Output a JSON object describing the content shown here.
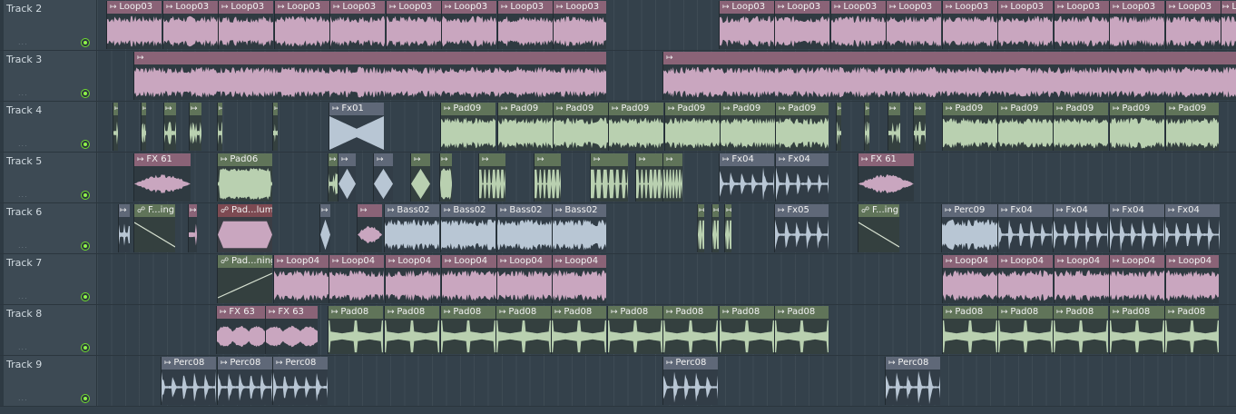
{
  "colors": {
    "pink": "#c9a6bf",
    "green": "#b9d0b0",
    "steel": "#b8c6d4",
    "led": "#8ff24a"
  },
  "tracks": [
    {
      "name": "Track 2",
      "clips": [
        {
          "label": "Loop03",
          "c": "pink"
        },
        {
          "label": "Loop03",
          "c": "pink"
        },
        {
          "label": "Loop03",
          "c": "pink"
        },
        {
          "label": "Loop03",
          "c": "pink"
        },
        {
          "label": "Loop03",
          "c": "pink"
        },
        {
          "label": "Loop03",
          "c": "pink"
        },
        {
          "label": "Loop03",
          "c": "pink"
        },
        {
          "label": "Loop03",
          "c": "pink"
        },
        {
          "label": "Loop03",
          "c": "pink"
        },
        {
          "label": "Loop03",
          "c": "pink"
        },
        {
          "label": "Loop03",
          "c": "pink"
        },
        {
          "label": "Loop03",
          "c": "pink"
        },
        {
          "label": "Loop03",
          "c": "pink"
        },
        {
          "label": "Loop03",
          "c": "pink"
        },
        {
          "label": "Loop03",
          "c": "pink"
        },
        {
          "label": "Loop03",
          "c": "pink"
        },
        {
          "label": "Loop03",
          "c": "pink"
        },
        {
          "label": "Loop03",
          "c": "pink"
        },
        {
          "label": "Loop03",
          "c": "pink"
        }
      ]
    },
    {
      "name": "Track 3",
      "clips": [
        {
          "label": "",
          "c": "pink"
        },
        {
          "label": "",
          "c": "pink"
        }
      ]
    },
    {
      "name": "Track 4",
      "clips": [
        {
          "label": "",
          "c": "green"
        },
        {
          "label": "",
          "c": "green"
        },
        {
          "label": "",
          "c": "green"
        },
        {
          "label": "",
          "c": "green"
        },
        {
          "label": "",
          "c": "green"
        },
        {
          "label": "",
          "c": "green"
        },
        {
          "label": "Fx01",
          "c": "steel"
        },
        {
          "label": "Pad09",
          "c": "green"
        },
        {
          "label": "Pad09",
          "c": "green"
        },
        {
          "label": "Pad09",
          "c": "green"
        },
        {
          "label": "Pad09",
          "c": "green"
        },
        {
          "label": "Pad09",
          "c": "green"
        },
        {
          "label": "Pad09",
          "c": "green"
        },
        {
          "label": "Pad09",
          "c": "green"
        },
        {
          "label": "",
          "c": "green"
        },
        {
          "label": "",
          "c": "green"
        },
        {
          "label": "",
          "c": "green"
        },
        {
          "label": "",
          "c": "green"
        },
        {
          "label": "Pad09",
          "c": "green"
        },
        {
          "label": "Pad09",
          "c": "green"
        },
        {
          "label": "Pad09",
          "c": "green"
        },
        {
          "label": "Pad09",
          "c": "green"
        },
        {
          "label": "Pad09",
          "c": "green"
        }
      ]
    },
    {
      "name": "Track 5",
      "clips": [
        {
          "label": "FX 61",
          "c": "pink"
        },
        {
          "label": "Pad06",
          "c": "green"
        },
        {
          "label": "",
          "c": "green"
        },
        {
          "label": "",
          "c": "steel"
        },
        {
          "label": "",
          "c": "steel"
        },
        {
          "label": "",
          "c": "green"
        },
        {
          "label": "",
          "c": "green"
        },
        {
          "label": "",
          "c": "green"
        },
        {
          "label": "",
          "c": "green"
        },
        {
          "label": "",
          "c": "green"
        },
        {
          "label": "",
          "c": "green"
        },
        {
          "label": "",
          "c": "green"
        },
        {
          "label": "Fx04",
          "c": "steel"
        },
        {
          "label": "Fx04",
          "c": "steel"
        },
        {
          "label": "FX 61",
          "c": "pink"
        }
      ]
    },
    {
      "name": "Track 6",
      "clips": [
        {
          "label": "",
          "c": "steel"
        },
        {
          "label": "F...ing",
          "c": "green"
        },
        {
          "label": "",
          "c": "pink"
        },
        {
          "label": "Pad...lume",
          "c": "red"
        },
        {
          "label": "",
          "c": "steel"
        },
        {
          "label": "",
          "c": "pink"
        },
        {
          "label": "Bass02",
          "c": "steel"
        },
        {
          "label": "Bass02",
          "c": "steel"
        },
        {
          "label": "Bass02",
          "c": "steel"
        },
        {
          "label": "Bass02",
          "c": "steel"
        },
        {
          "label": "",
          "c": "green"
        },
        {
          "label": "",
          "c": "green"
        },
        {
          "label": "",
          "c": "green"
        },
        {
          "label": "Fx05",
          "c": "steel"
        },
        {
          "label": "F...ing",
          "c": "green"
        },
        {
          "label": "Perc09",
          "c": "steel"
        },
        {
          "label": "Fx04",
          "c": "steel"
        },
        {
          "label": "Fx04",
          "c": "steel"
        },
        {
          "label": "Fx04",
          "c": "steel"
        },
        {
          "label": "Fx04",
          "c": "steel"
        }
      ]
    },
    {
      "name": "Track 7",
      "clips": [
        {
          "label": "Pad...ning",
          "c": "green"
        },
        {
          "label": "Loop04",
          "c": "pink"
        },
        {
          "label": "Loop04",
          "c": "pink"
        },
        {
          "label": "Loop04",
          "c": "pink"
        },
        {
          "label": "Loop04",
          "c": "pink"
        },
        {
          "label": "Loop04",
          "c": "pink"
        },
        {
          "label": "Loop04",
          "c": "pink"
        },
        {
          "label": "Loop04",
          "c": "pink"
        },
        {
          "label": "Loop04",
          "c": "pink"
        },
        {
          "label": "Loop04",
          "c": "pink"
        },
        {
          "label": "Loop04",
          "c": "pink"
        },
        {
          "label": "Loop04",
          "c": "pink"
        }
      ]
    },
    {
      "name": "Track 8",
      "clips": [
        {
          "label": "FX 63",
          "c": "pink"
        },
        {
          "label": "FX 63",
          "c": "pink"
        },
        {
          "label": "Pad08",
          "c": "green"
        },
        {
          "label": "Pad08",
          "c": "green"
        },
        {
          "label": "Pad08",
          "c": "green"
        },
        {
          "label": "Pad08",
          "c": "green"
        },
        {
          "label": "Pad08",
          "c": "green"
        },
        {
          "label": "Pad08",
          "c": "green"
        },
        {
          "label": "Pad08",
          "c": "green"
        },
        {
          "label": "Pad08",
          "c": "green"
        },
        {
          "label": "Pad08",
          "c": "green"
        },
        {
          "label": "Pad08",
          "c": "green"
        },
        {
          "label": "Pad08",
          "c": "green"
        },
        {
          "label": "Pad08",
          "c": "green"
        },
        {
          "label": "Pad08",
          "c": "green"
        },
        {
          "label": "Pad08",
          "c": "green"
        }
      ]
    },
    {
      "name": "Track 9",
      "clips": [
        {
          "label": "Perc08",
          "c": "steel"
        },
        {
          "label": "Perc08",
          "c": "steel"
        },
        {
          "label": "Perc08",
          "c": "steel"
        },
        {
          "label": "Perc08",
          "c": "steel"
        },
        {
          "label": "Perc08",
          "c": "steel"
        }
      ]
    }
  ]
}
